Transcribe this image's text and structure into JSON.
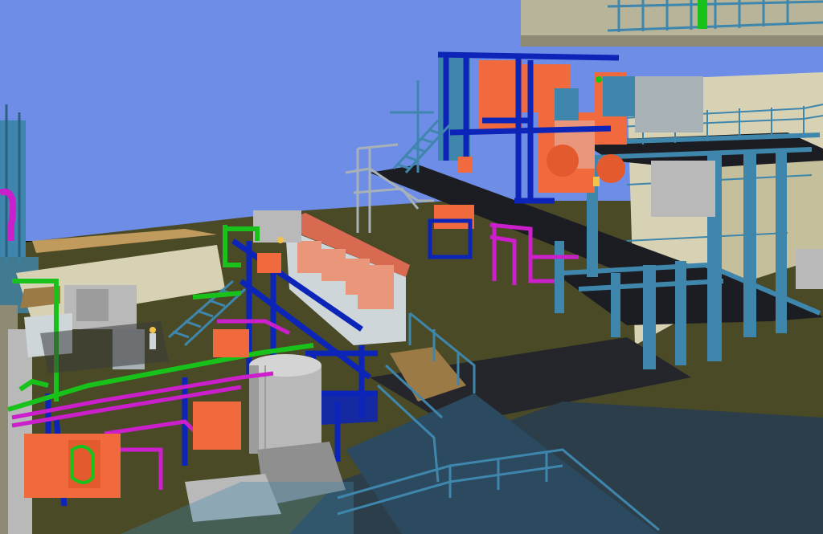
{
  "scene": {
    "view": "3D plant model",
    "colors": {
      "sky": "#6e8de6",
      "ground": "#4a4a26",
      "floor_dark": "#25262c",
      "structure": "#3f86ad",
      "structure_dark": "#2c5f82",
      "beam_navy": "#0c24b8",
      "equipment_orange": "#f06a3e",
      "equipment_salmon": "#e9967a",
      "pipe_green": "#19c21a",
      "pipe_magenta": "#cc1fcc",
      "vessel_gray": "#b9b9b9",
      "panel_light": "#cfd6d9",
      "wall_beige": "#d8d2b4",
      "grating": "#9c7a45"
    }
  }
}
